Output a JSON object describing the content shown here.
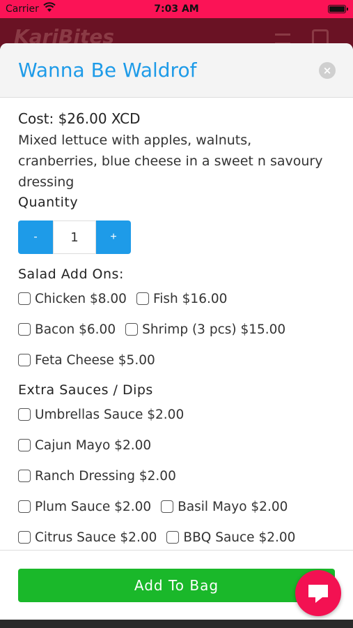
{
  "status_bar": {
    "carrier": "Carrier",
    "time": "7:03 AM"
  },
  "app_header": {
    "logo": "KariBites"
  },
  "modal": {
    "title": "Wanna Be Waldrof",
    "close_icon": "×",
    "cost_label": "Cost:",
    "cost_value": "$26.00 XCD",
    "description": "Mixed lettuce with apples, walnuts, cranberries, blue cheese in a sweet n savoury dressing",
    "quantity_label": "Quantity",
    "quantity": {
      "minus": "-",
      "value": "1",
      "plus": "+"
    },
    "salad_addons": {
      "title": "Salad Add Ons:",
      "options": [
        "Chicken $8.00",
        "Fish $16.00",
        "Bacon $6.00",
        "Shrimp (3 pcs) $15.00",
        "Feta Cheese $5.00"
      ]
    },
    "extra_sauces": {
      "title": "Extra Sauces / Dips",
      "options": [
        "Umbrellas Sauce $2.00",
        "Cajun Mayo $2.00",
        "Ranch Dressing $2.00",
        "Plum Sauce $2.00",
        "Basil Mayo $2.00",
        "Citrus Sauce $2.00",
        "BBQ Sauce $2.00"
      ]
    },
    "add_button": "Add To Bag"
  },
  "colors": {
    "accent": "#1e9be8",
    "add_button": "#1ab82a",
    "status_bar": "#fb1356",
    "chat_fab": "#f31152"
  },
  "icons": {
    "close": "close-icon",
    "chat": "chat-icon",
    "menu": "menu-icon",
    "bag": "shopping-bag-icon",
    "wifi": "wifi-icon",
    "battery": "battery-icon"
  }
}
